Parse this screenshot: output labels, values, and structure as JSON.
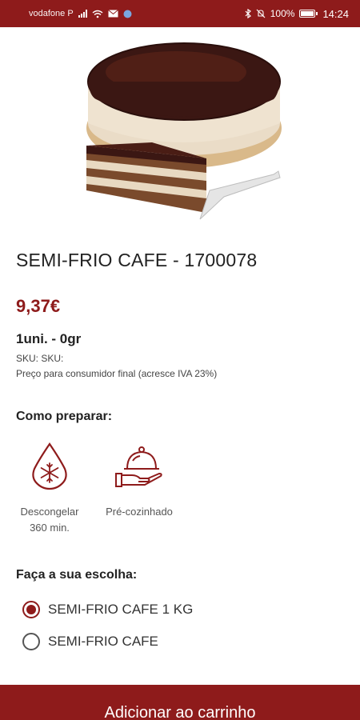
{
  "status_bar": {
    "carrier": "vodafone P",
    "battery": "100%",
    "time": "14:24"
  },
  "product": {
    "image_alt": "cake-photo",
    "title": "SEMI-FRIO CAFE - 1700078",
    "price": "9,37€",
    "unit_weight": "1uni. - 0gr",
    "sku": "SKU:   SKU:",
    "price_note": "Preço para consumidor final (acresce IVA 23%)"
  },
  "preparation": {
    "title": "Como preparar:",
    "items": [
      {
        "icon": "snowflake-drop-icon",
        "label": "Descongelar",
        "detail": "360 min."
      },
      {
        "icon": "cloche-serving-icon",
        "label": "Pré-cozinhado"
      }
    ]
  },
  "choice": {
    "title": "Faça a sua escolha:",
    "options": [
      {
        "label": "SEMI-FRIO CAFE 1 KG",
        "selected": true
      },
      {
        "label": "SEMI-FRIO CAFE",
        "selected": false
      }
    ]
  },
  "cart_button": {
    "label": "Adicionar ao carrinho"
  },
  "colors": {
    "accent": "#8e1b1b"
  }
}
